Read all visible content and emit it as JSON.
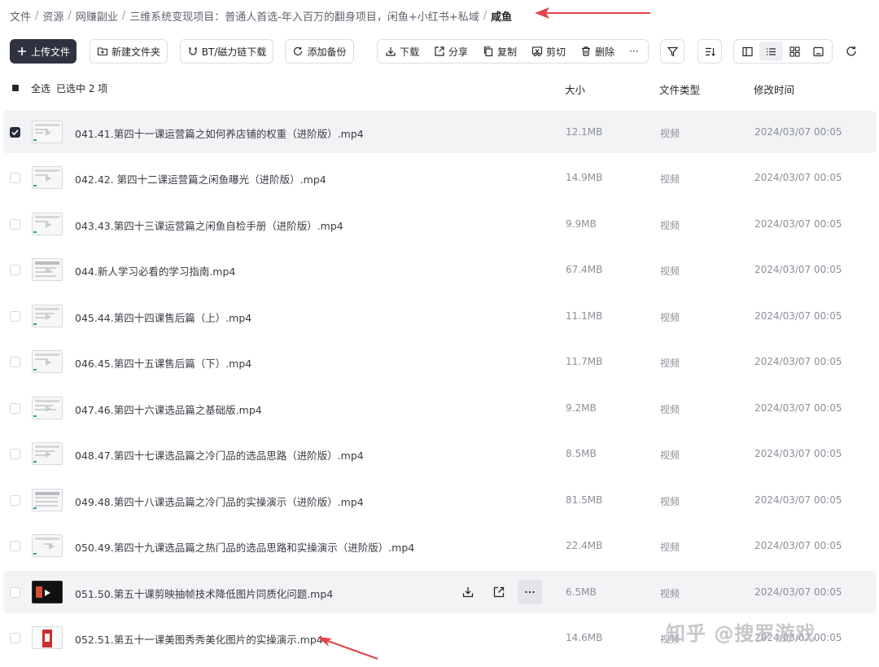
{
  "breadcrumb": {
    "items": [
      "文件",
      "资源",
      "网赚副业",
      "三维系统变现项目：普通人首选-年入百万的翻身项目，闲鱼+小红书+私域",
      "咸鱼"
    ],
    "separator": "/"
  },
  "toolbar": {
    "upload_label": "上传文件",
    "new_folder_label": "新建文件夹",
    "bt_label": "BT/磁力链下载",
    "backup_label": "添加备份",
    "download_label": "下载",
    "share_label": "分享",
    "copy_label": "复制",
    "cut_label": "剪切",
    "delete_label": "删除",
    "more_label": "···"
  },
  "header": {
    "select_all": "全选",
    "selected_text": "已选中 2 项",
    "col_size": "大小",
    "col_type": "文件类型",
    "col_time": "修改时间"
  },
  "files": [
    {
      "name": "041.41.第四十一课运营篇之如何养店铺的权重（进阶版）.mp4",
      "size": "12.1MB",
      "type": "视频",
      "time": "2024/03/07 00:05"
    },
    {
      "name": "042.42. 第四十二课运营篇之闲鱼曝光（进阶版）.mp4",
      "size": "14.9MB",
      "type": "视频",
      "time": "2024/03/07 00:05"
    },
    {
      "name": "043.43.第四十三课运营篇之闲鱼自检手册（进阶版）.mp4",
      "size": "9.9MB",
      "type": "视频",
      "time": "2024/03/07 00:05"
    },
    {
      "name": "044.新人学习必看的学习指南.mp4",
      "size": "67.4MB",
      "type": "视频",
      "time": "2024/03/07 00:05"
    },
    {
      "name": "045.44.第四十四课售后篇（上）.mp4",
      "size": "11.1MB",
      "type": "视频",
      "time": "2024/03/07 00:05"
    },
    {
      "name": "046.45.第四十五课售后篇（下）.mp4",
      "size": "11.7MB",
      "type": "视频",
      "time": "2024/03/07 00:05"
    },
    {
      "name": "047.46.第四十六课选品篇之基础版.mp4",
      "size": "9.2MB",
      "type": "视频",
      "time": "2024/03/07 00:05"
    },
    {
      "name": "048.47.第四十七课选品篇之冷门品的选品思路（进阶版）.mp4",
      "size": "8.5MB",
      "type": "视频",
      "time": "2024/03/07 00:05"
    },
    {
      "name": "049.48.第四十八课选品篇之冷门品的实操演示（进阶版）.mp4",
      "size": "81.5MB",
      "type": "视频",
      "time": "2024/03/07 00:05"
    },
    {
      "name": "050.49.第四十九课选品篇之热门品的选品思路和实操演示（进阶版）.mp4",
      "size": "22.4MB",
      "type": "视频",
      "time": "2024/03/07 00:05"
    },
    {
      "name": "051.50.第五十课剪映抽帧技术降低图片同质化问题.mp4",
      "size": "6.5MB",
      "type": "视频",
      "time": "2024/03/07 00:05"
    },
    {
      "name": "052.51.第五十一课美图秀秀美化图片的实操演示.mp4",
      "size": "14.6MB",
      "type": "视频",
      "time": "2024/03/07 00:05"
    }
  ],
  "watermark": "知乎 @搜罗游戏",
  "colors": {
    "primary_button": "#2f3341",
    "row_highlight": "#f2f3f5",
    "annotation_arrow": "#e2444a"
  }
}
